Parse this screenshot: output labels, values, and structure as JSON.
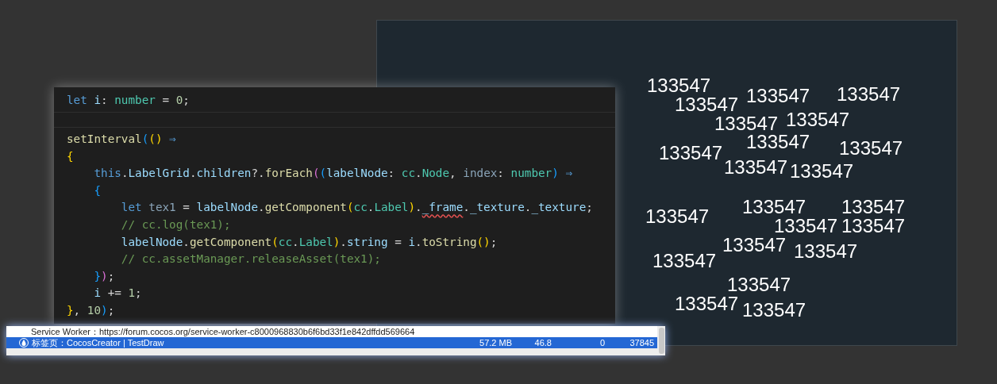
{
  "game_view": {
    "labels": [
      "133547",
      "133547",
      "133547",
      "133547",
      "133547",
      "133547",
      "133547",
      "133547",
      "133547",
      "133547",
      "133547",
      "133547",
      "133547",
      "133547",
      "133547",
      "133547",
      "133547",
      "133547",
      "133547",
      "133547",
      "133547",
      "133547"
    ]
  },
  "editor": {
    "sticky_line": [
      {
        "text": "let ",
        "kind": "keyword"
      },
      {
        "text": "i",
        "kind": "variable"
      },
      {
        "text": ": ",
        "kind": "plain"
      },
      {
        "text": "number",
        "kind": "type"
      },
      {
        "text": " = ",
        "kind": "plain"
      },
      {
        "text": "0",
        "kind": "number"
      },
      {
        "text": ";",
        "kind": "plain"
      }
    ],
    "lines": [
      [
        {
          "text": "setInterval",
          "kind": "function"
        },
        {
          "text": "(",
          "kind": "bracket-blue"
        },
        {
          "text": "()",
          "kind": "bracket-yellow"
        },
        {
          "text": " ⇒",
          "kind": "keyword"
        }
      ],
      [
        {
          "text": "{",
          "kind": "bracket-yellow"
        }
      ],
      [
        {
          "text": "    this",
          "kind": "keyword"
        },
        {
          "text": ".",
          "kind": "plain"
        },
        {
          "text": "LabelGrid",
          "kind": "variable"
        },
        {
          "text": ".",
          "kind": "plain"
        },
        {
          "text": "children",
          "kind": "variable"
        },
        {
          "text": "?.",
          "kind": "plain"
        },
        {
          "text": "forEach",
          "kind": "function"
        },
        {
          "text": "(",
          "kind": "bracket-pink"
        },
        {
          "text": "(",
          "kind": "bracket-blue"
        },
        {
          "text": "labelNode",
          "kind": "variable"
        },
        {
          "text": ": ",
          "kind": "plain"
        },
        {
          "text": "cc",
          "kind": "type"
        },
        {
          "text": ".",
          "kind": "plain"
        },
        {
          "text": "Node",
          "kind": "type"
        },
        {
          "text": ", ",
          "kind": "plain"
        },
        {
          "text": "index",
          "kind": "unused"
        },
        {
          "text": ": ",
          "kind": "plain"
        },
        {
          "text": "number",
          "kind": "type"
        },
        {
          "text": ")",
          "kind": "bracket-blue"
        },
        {
          "text": " ⇒",
          "kind": "keyword"
        }
      ],
      [
        {
          "text": "    {",
          "kind": "bracket-blue"
        }
      ],
      [
        {
          "text": "        let ",
          "kind": "keyword"
        },
        {
          "text": "tex1",
          "kind": "unused"
        },
        {
          "text": " = ",
          "kind": "plain"
        },
        {
          "text": "labelNode",
          "kind": "variable"
        },
        {
          "text": ".",
          "kind": "plain"
        },
        {
          "text": "getComponent",
          "kind": "function"
        },
        {
          "text": "(",
          "kind": "bracket-yellow"
        },
        {
          "text": "cc",
          "kind": "type"
        },
        {
          "text": ".",
          "kind": "plain"
        },
        {
          "text": "Label",
          "kind": "type"
        },
        {
          "text": ")",
          "kind": "bracket-yellow"
        },
        {
          "text": ".",
          "kind": "plain"
        },
        {
          "text": "_frame",
          "kind": "variable",
          "squiggle": true
        },
        {
          "text": ".",
          "kind": "plain"
        },
        {
          "text": "_texture",
          "kind": "variable"
        },
        {
          "text": ".",
          "kind": "plain"
        },
        {
          "text": "_texture",
          "kind": "variable"
        },
        {
          "text": ";",
          "kind": "plain"
        }
      ],
      [
        {
          "text": "        // cc.log(tex1);",
          "kind": "comment"
        }
      ],
      [
        {
          "text": "        labelNode",
          "kind": "variable"
        },
        {
          "text": ".",
          "kind": "plain"
        },
        {
          "text": "getComponent",
          "kind": "function"
        },
        {
          "text": "(",
          "kind": "bracket-yellow"
        },
        {
          "text": "cc",
          "kind": "type"
        },
        {
          "text": ".",
          "kind": "plain"
        },
        {
          "text": "Label",
          "kind": "type"
        },
        {
          "text": ")",
          "kind": "bracket-yellow"
        },
        {
          "text": ".",
          "kind": "plain"
        },
        {
          "text": "string",
          "kind": "variable"
        },
        {
          "text": " = ",
          "kind": "plain"
        },
        {
          "text": "i",
          "kind": "variable"
        },
        {
          "text": ".",
          "kind": "plain"
        },
        {
          "text": "toString",
          "kind": "function"
        },
        {
          "text": "()",
          "kind": "bracket-yellow"
        },
        {
          "text": ";",
          "kind": "plain"
        }
      ],
      [
        {
          "text": "        // cc.assetManager.releaseAsset(tex1);",
          "kind": "comment"
        }
      ],
      [
        {
          "text": "    }",
          "kind": "bracket-blue"
        },
        {
          "text": ")",
          "kind": "bracket-pink"
        },
        {
          "text": ";",
          "kind": "plain"
        }
      ],
      [
        {
          "text": "    i",
          "kind": "variable"
        },
        {
          "text": " += ",
          "kind": "plain"
        },
        {
          "text": "1",
          "kind": "number"
        },
        {
          "text": ";",
          "kind": "plain"
        }
      ],
      [
        {
          "text": "}",
          "kind": "bracket-yellow"
        },
        {
          "text": ", ",
          "kind": "plain"
        },
        {
          "text": "10",
          "kind": "number"
        },
        {
          "text": ")",
          "kind": "bracket-blue"
        },
        {
          "text": ";",
          "kind": "plain"
        }
      ]
    ]
  },
  "task_manager": {
    "rows": [
      {
        "kind": "service-worker",
        "name": "Service Worker：https://forum.cocos.org/service-worker-c8000968830b6f6bd33f1e842dffdd569664",
        "cells": [],
        "selected": false
      },
      {
        "kind": "tab",
        "name": "标签页：CocosCreator | TestDraw",
        "cells": [
          "57.2 MB",
          "46.8",
          "0",
          "37845"
        ],
        "selected": true
      }
    ]
  }
}
